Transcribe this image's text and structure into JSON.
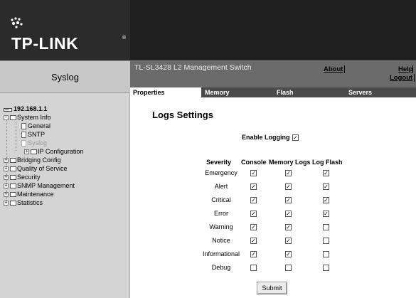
{
  "brand": {
    "logo_text": "TP-LINK",
    "registered_mark": "®"
  },
  "page_title": "Syslog",
  "product": {
    "name": "TL-SL3428 L2 Management Switch"
  },
  "top_links": {
    "about": "About",
    "help": "Help",
    "logout": "Logout"
  },
  "tabs": [
    {
      "label": "Properties",
      "active": true
    },
    {
      "label": "Memory",
      "active": false
    },
    {
      "label": "Flash",
      "active": false
    },
    {
      "label": "Servers",
      "active": false
    }
  ],
  "sidebar": {
    "root": "192.168.1.1",
    "system_info": {
      "label": "System Info",
      "children": [
        "General",
        "SNTP",
        "Syslog"
      ],
      "ip_config": "IP Configuration"
    },
    "folders": [
      "Bridging Config",
      "Quality of Service",
      "Security",
      "SNMP Management",
      "Maintenance",
      "Statistics"
    ]
  },
  "main": {
    "heading": "Logs Settings",
    "enable_logging_label": "Enable Logging",
    "enable_logging": true,
    "columns": {
      "severity": "Severity",
      "console": "Console",
      "memory": "Memory Logs",
      "flash": "Log Flash"
    },
    "rows": [
      {
        "severity": "Emergency",
        "console": true,
        "memory": true,
        "flash": true
      },
      {
        "severity": "Alert",
        "console": true,
        "memory": true,
        "flash": true
      },
      {
        "severity": "Critical",
        "console": true,
        "memory": true,
        "flash": true
      },
      {
        "severity": "Error",
        "console": true,
        "memory": true,
        "flash": true
      },
      {
        "severity": "Warning",
        "console": true,
        "memory": true,
        "flash": false
      },
      {
        "severity": "Notice",
        "console": true,
        "memory": true,
        "flash": false
      },
      {
        "severity": "Informational",
        "console": true,
        "memory": true,
        "flash": false
      },
      {
        "severity": "Debug",
        "console": false,
        "memory": false,
        "flash": false
      }
    ],
    "submit_label": "Submit"
  }
}
